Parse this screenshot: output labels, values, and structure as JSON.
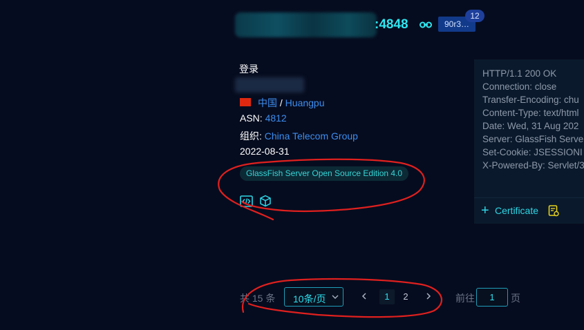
{
  "header": {
    "port": ":4848",
    "tag": "90r3…",
    "badge_count": "12"
  },
  "info": {
    "title": "登录",
    "country": "中国",
    "separator": " / ",
    "city": "Huangpu",
    "asn_label": "ASN: ",
    "asn_value": "4812",
    "org_label": "组织: ",
    "org_value": "China Telecom Group",
    "date": "2022-08-31",
    "product_tag": "GlassFish Server Open Source Edition 4.0",
    "icons": [
      "code-icon",
      "cube-icon"
    ]
  },
  "http_response": {
    "lines": [
      "HTTP/1.1 200 OK",
      "Connection: close",
      "Transfer-Encoding: chu",
      "Content-Type: text/html",
      "Date: Wed, 31 Aug 202",
      "Server: GlassFish Serve",
      "Set-Cookie: JSESSIONI",
      "X-Powered-By: Servlet/3"
    ],
    "certificate_label": "Certificate"
  },
  "pagination": {
    "total": "共 15 条",
    "page_size": "10条/页",
    "pages": [
      "1",
      "2"
    ],
    "current_page": "1",
    "goto_label": "前往",
    "goto_value": "1",
    "goto_suffix": "页"
  },
  "colors": {
    "background": "#060c1f",
    "accent": "#2ee0ee",
    "link": "#3d8ef0",
    "annotation": "#e0201e"
  }
}
